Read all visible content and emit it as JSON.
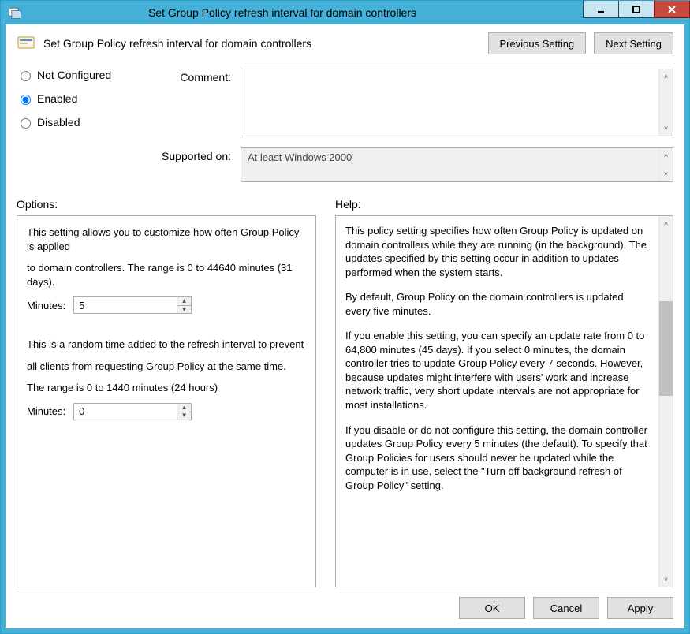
{
  "titlebar": {
    "title": "Set Group Policy refresh interval for domain controllers"
  },
  "header": {
    "policy_name": "Set Group Policy refresh interval for domain controllers",
    "prev_label": "Previous Setting",
    "next_label": "Next Setting"
  },
  "state": {
    "not_configured_label": "Not Configured",
    "enabled_label": "Enabled",
    "disabled_label": "Disabled",
    "selected": "enabled"
  },
  "fields": {
    "comment_label": "Comment:",
    "comment_value": "",
    "supported_label": "Supported on:",
    "supported_value": "At least Windows 2000"
  },
  "labels": {
    "options": "Options:",
    "help": "Help:"
  },
  "options": {
    "intro1": "This setting allows you to customize how often Group Policy is applied",
    "intro2": "to domain controllers. The range is 0 to 44640 minutes (31 days).",
    "minutes_label": "Minutes:",
    "minutes1_value": "5",
    "random1": "This is a random time added to the refresh interval to prevent",
    "random2": "all clients from requesting Group Policy at the same time.",
    "range2": "The range is 0 to 1440 minutes (24 hours)",
    "minutes2_value": "0"
  },
  "help": {
    "p1": "This policy setting specifies how often Group Policy is updated on domain controllers while they are running (in the background). The updates specified by this setting occur in addition to updates performed when the system starts.",
    "p2": "By default, Group Policy on the domain controllers is updated every five minutes.",
    "p3": "If you enable this setting, you can specify an update rate from 0 to 64,800 minutes (45 days). If you select 0 minutes, the domain controller tries to update Group Policy every 7 seconds. However, because updates might interfere with users' work and increase network traffic, very short update intervals are not appropriate for most installations.",
    "p4": "If you disable or do not configure this setting, the domain controller updates Group Policy every 5 minutes (the default). To specify that Group Policies for users should never be updated while the computer is in use, select the \"Turn off background refresh of Group Policy\" setting."
  },
  "footer": {
    "ok": "OK",
    "cancel": "Cancel",
    "apply": "Apply"
  }
}
